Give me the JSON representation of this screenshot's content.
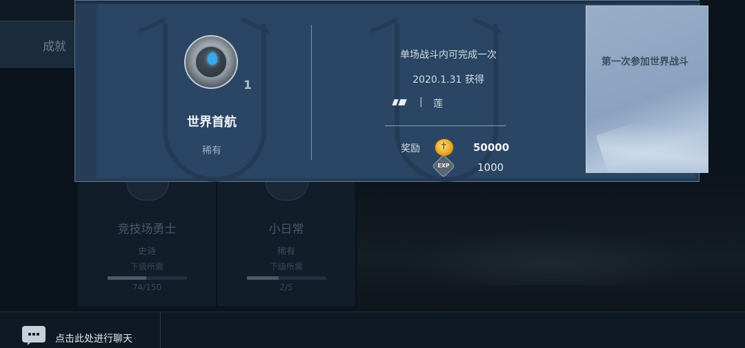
{
  "background": {
    "side_tab_label": "成就",
    "cards": [
      {
        "title": "竞技场勇士",
        "rarity": "史诗",
        "requirement": "下级所需",
        "progress_text": "74/150",
        "progress": 0.49
      },
      {
        "title": "小日常",
        "rarity": "稀有",
        "requirement": "下级所需",
        "progress_text": "2/5",
        "progress": 0.4
      }
    ]
  },
  "popup": {
    "achievement": {
      "icon": "water-drop-medal-icon",
      "level": "1",
      "name": "世界首航",
      "rarity": "稀有"
    },
    "condition": "单场战斗内可完成一次",
    "obtained": "2020.1.31 获得",
    "tag": {
      "icon": "ship-tag-icon",
      "separator": "|",
      "name": "莲"
    },
    "reward": {
      "label": "奖励",
      "items": [
        {
          "icon": "gold-coin-icon",
          "value": "50000"
        },
        {
          "icon": "exp-icon",
          "icon_text": "EXP",
          "value": "1000"
        }
      ]
    },
    "description": "第一次参加世界战斗"
  },
  "chat": {
    "icon": "chat-bubble-icon",
    "placeholder": "点击此处进行聊天"
  }
}
